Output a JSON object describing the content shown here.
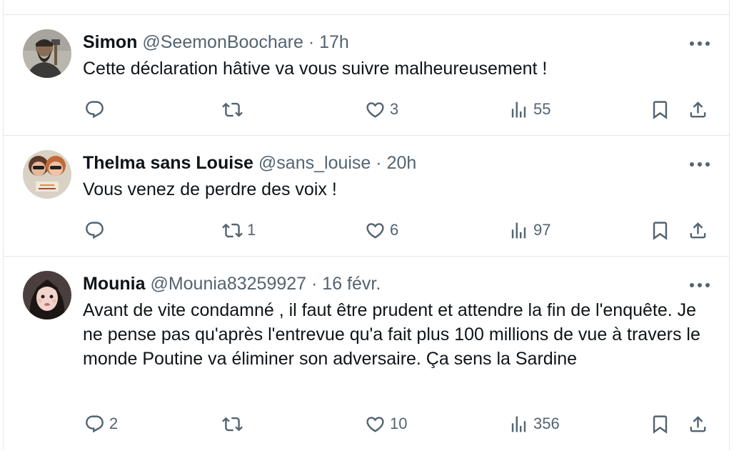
{
  "tweets": [
    {
      "name": "Simon",
      "handle": "@SeemonBoochare",
      "separator": "·",
      "time": "17h",
      "text": "Cette déclaration hâtive va vous suivre malheureusement !",
      "replies": "",
      "retweets": "",
      "likes": "3",
      "views": "55"
    },
    {
      "name": "Thelma sans Louise",
      "handle": "@sans_louise",
      "separator": "·",
      "time": "20h",
      "text": "Vous venez de perdre des voix !",
      "replies": "",
      "retweets": "1",
      "likes": "6",
      "views": "97"
    },
    {
      "name": "Mounia",
      "handle": "@Mounia83259927",
      "separator": "·",
      "time": "16 févr.",
      "text": "Avant de vite condamné , il faut être prudent et  attendre la fin de l'enquête. Je ne pense pas qu'après l'entrevue qu'a fait plus 100 millions de vue à travers le monde Poutine va éliminer son adversaire. Ça sens la Sardine",
      "replies": "2",
      "retweets": "",
      "likes": "10",
      "views": "356"
    }
  ],
  "colors": {
    "text_primary": "#0f1419",
    "text_secondary": "#536471",
    "border": "#e7e7e7"
  },
  "icons": [
    "more-icon",
    "reply-icon",
    "retweet-icon",
    "like-icon",
    "views-icon",
    "bookmark-icon",
    "share-icon"
  ]
}
